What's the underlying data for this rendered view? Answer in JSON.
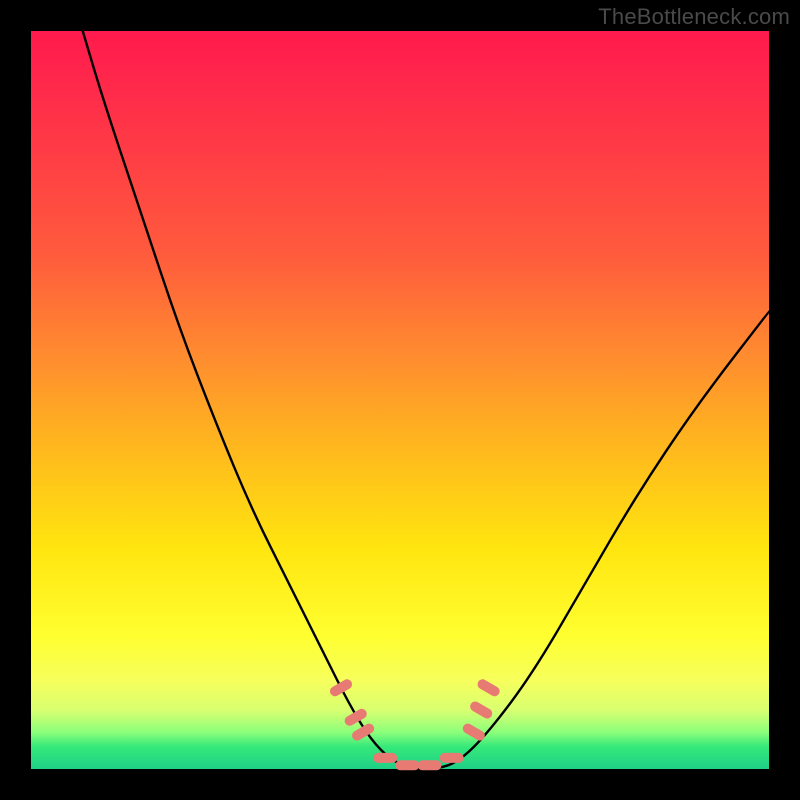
{
  "watermark": "TheBottleneck.com",
  "chart_data": {
    "type": "line",
    "title": "",
    "xlabel": "",
    "ylabel": "",
    "xlim": [
      0,
      100
    ],
    "ylim": [
      0,
      100
    ],
    "grid": false,
    "legend": false,
    "background_gradient": {
      "orientation": "vertical",
      "stops": [
        {
          "pos": 0,
          "color": "#ff1a4d"
        },
        {
          "pos": 30,
          "color": "#ff5a3d"
        },
        {
          "pos": 55,
          "color": "#ffb31f"
        },
        {
          "pos": 82,
          "color": "#ffff30"
        },
        {
          "pos": 95,
          "color": "#8cff7a"
        },
        {
          "pos": 100,
          "color": "#1fcf86"
        }
      ]
    },
    "series": [
      {
        "name": "bottleneck-curve",
        "color": "#000000",
        "x": [
          7,
          10,
          15,
          20,
          25,
          30,
          35,
          40,
          43,
          46,
          49,
          52,
          55,
          58,
          62,
          68,
          75,
          82,
          90,
          100
        ],
        "y": [
          100,
          90,
          75,
          60,
          47,
          35,
          25,
          15,
          9,
          4,
          1,
          0,
          0,
          1,
          5,
          13,
          25,
          37,
          49,
          62
        ]
      }
    ],
    "markers": {
      "name": "highlight-dots",
      "shape": "rounded-capsule",
      "color": "#e77b74",
      "points": [
        {
          "x": 42,
          "y": 11
        },
        {
          "x": 44,
          "y": 7
        },
        {
          "x": 45,
          "y": 5
        },
        {
          "x": 48,
          "y": 1.5
        },
        {
          "x": 51,
          "y": 0.5
        },
        {
          "x": 54,
          "y": 0.5
        },
        {
          "x": 57,
          "y": 1.5
        },
        {
          "x": 60,
          "y": 5
        },
        {
          "x": 61,
          "y": 8
        },
        {
          "x": 62,
          "y": 11
        }
      ]
    }
  }
}
